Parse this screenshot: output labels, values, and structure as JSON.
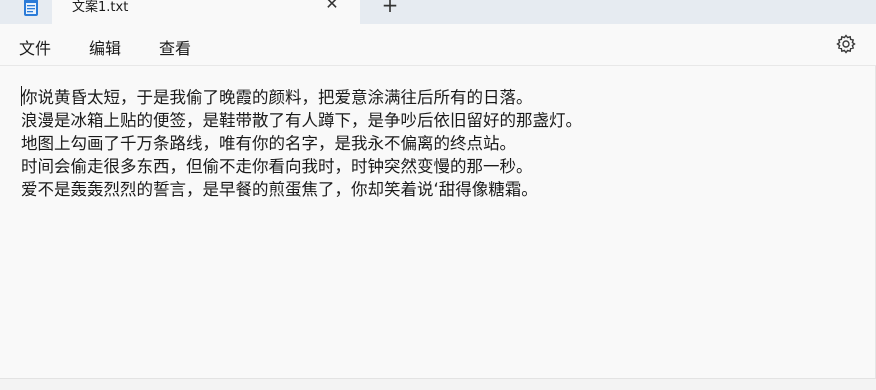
{
  "window": {
    "tab_title": "文案1.txt",
    "close_glyph": "✕",
    "new_tab_glyph": "+"
  },
  "menu": {
    "file": "文件",
    "edit": "编辑",
    "view": "查看"
  },
  "icons": {
    "app": "notepad-icon",
    "settings": "gear-icon"
  },
  "colors": {
    "titlebar_bg": "#e6ebf1",
    "editor_bg": "#f9f9f9",
    "text": "#1a1a1a"
  },
  "document": {
    "lines": [
      "你说黄昏太短，于是我偷了晚霞的颜料，把爱意涂满往后所有的日落。",
      "浪漫是冰箱上贴的便签，是鞋带散了有人蹲下，是争吵后依旧留好的那盏灯。",
      "地图上勾画了千万条路线，唯有你的名字，是我永不偏离的终点站。",
      "时间会偷走很多东西，但偷不走你看向我时，时钟突然变慢的那一秒。",
      "爱不是轰轰烈烈的誓言，是早餐的煎蛋焦了，你却笑着说‘甜得像糖霜。"
    ]
  }
}
